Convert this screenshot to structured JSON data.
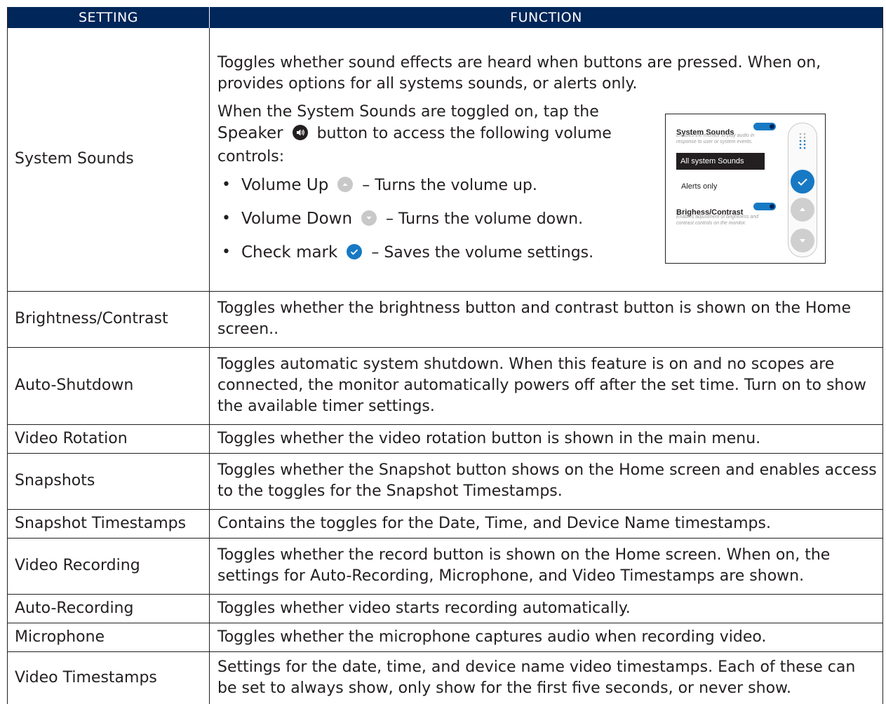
{
  "table": {
    "headers": [
      "SETTING",
      "FUNCTION"
    ],
    "system_sounds": {
      "setting": "System Sounds",
      "intro": "Toggles whether sound effects are heard when buttons are pressed. When on, provides options for all systems sounds, or alerts only.",
      "para_a": "When the System Sounds are toggled on, tap the",
      "speaker_label": "Speaker",
      "para_b": "button to access the following volume controls:",
      "items": [
        {
          "name": "Volume Up",
          "icon": "volume-up-icon",
          "desc": "– Turns the volume up."
        },
        {
          "name": "Volume Down",
          "icon": "volume-down-icon",
          "desc": "– Turns the volume down."
        },
        {
          "name": "Check mark",
          "icon": "check-mark-icon",
          "desc": "– Saves the volume settings."
        }
      ],
      "inset": {
        "title1": "System Sounds",
        "desc1": "Enables the monitor to play audio in response to user or system events.",
        "option_selected": "All system Sounds",
        "option_other": "Alerts only",
        "title2": "Brighess/Contrast",
        "desc2": "Enables adjustment of brightness and contrast controls on the monitor."
      }
    },
    "rows": [
      {
        "setting": "Brightness/Contrast",
        "function": "Toggles whether the brightness button and contrast button is shown on the Home screen.."
      },
      {
        "setting": "Auto-Shutdown",
        "function": "Toggles automatic system shutdown. When this feature is on and no scopes are connected, the monitor automatically powers off after the set time. Turn on to show the available timer settings."
      },
      {
        "setting": "Video Rotation",
        "function": "Toggles whether the video rotation button is shown in the main menu."
      },
      {
        "setting": "Snapshots",
        "function": "Toggles whether the Snapshot button shows on the Home screen and enables access to the toggles for the Snapshot Timestamps."
      },
      {
        "setting": "Snapshot Timestamps",
        "function": "Contains the toggles for the Date, Time, and Device Name timestamps."
      },
      {
        "setting": "Video Recording",
        "function": "Toggles whether the record button is shown on the Home screen. When on, the settings for Auto-Recording, Microphone, and Video Timestamps are shown."
      },
      {
        "setting": "Auto-Recording",
        "function": "Toggles whether video starts recording automatically."
      },
      {
        "setting": "Microphone",
        "function": "Toggles whether the microphone captures audio when recording video."
      },
      {
        "setting": "Video Timestamps",
        "function": "Settings for the date, time, and device name video timestamps. Each of these can be set to always show, only show for the first five seconds, or never show."
      }
    ]
  },
  "colors": {
    "header_bg": "#00265a",
    "accent_blue": "#1779c4",
    "icon_gray": "#c8c8c8",
    "text": "#231f20"
  }
}
